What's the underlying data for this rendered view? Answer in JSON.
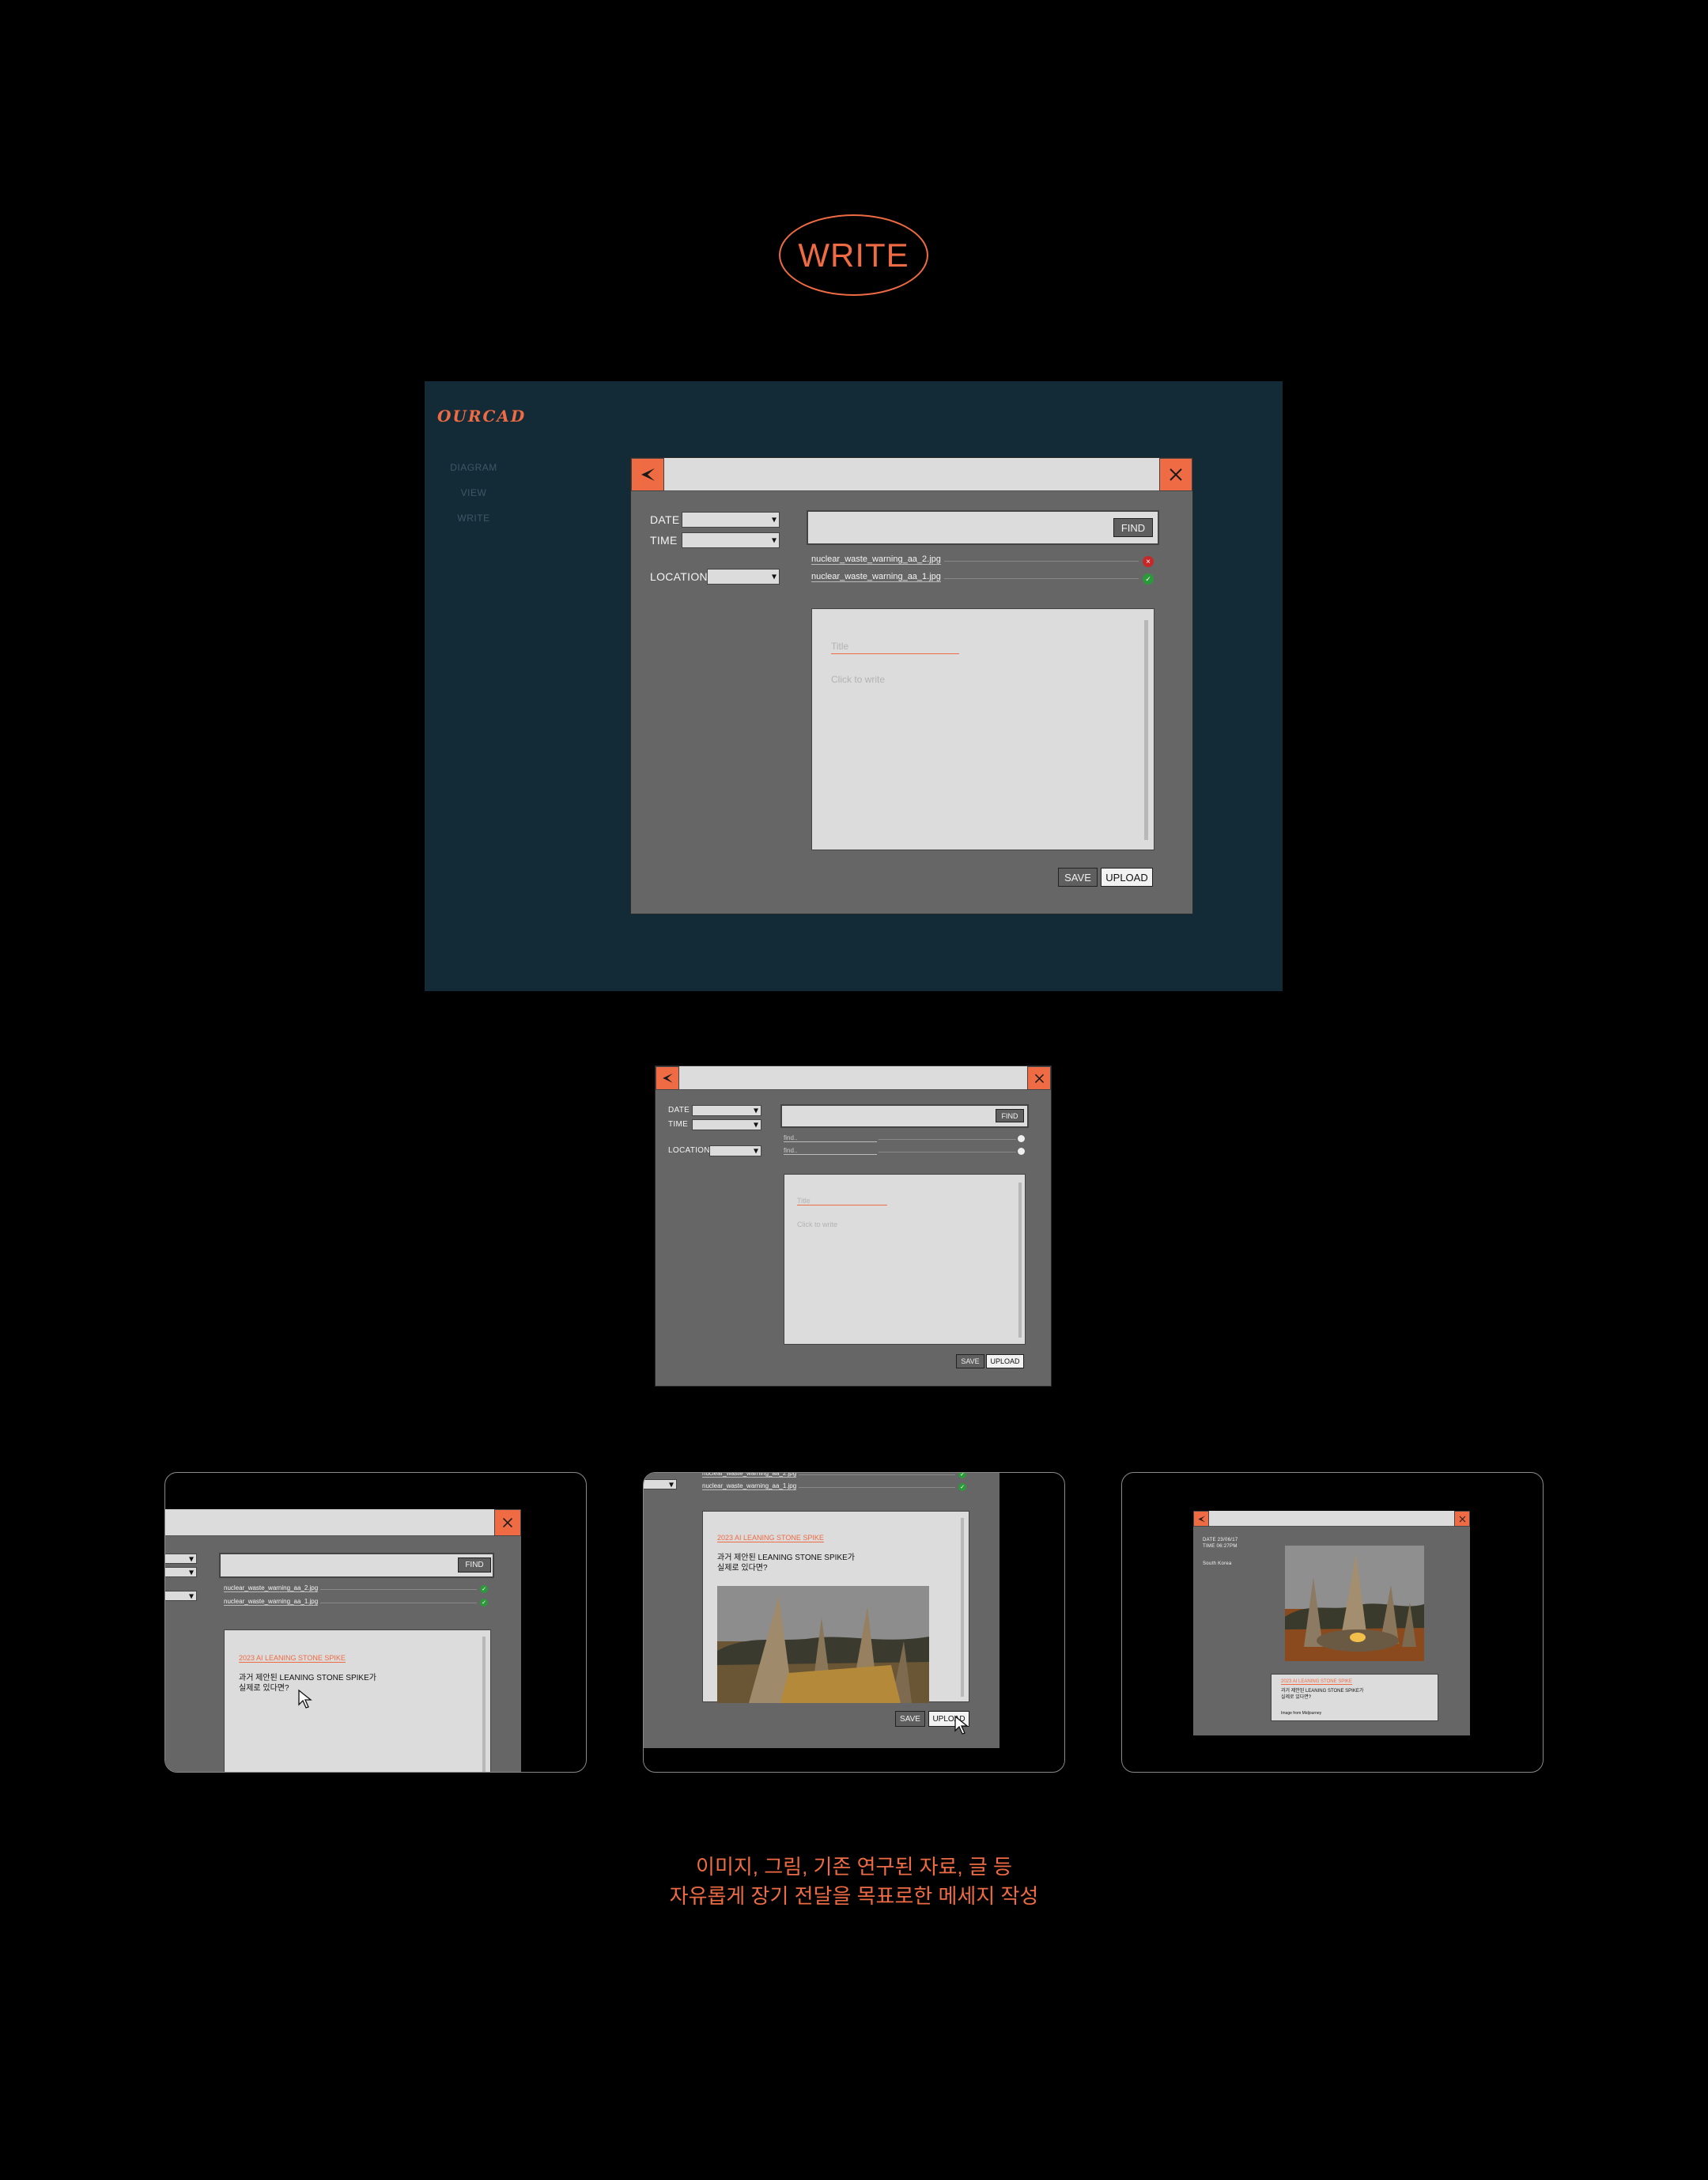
{
  "heading": {
    "label": "WRITE"
  },
  "app": {
    "logo": "OURCAD",
    "nav": [
      "DIAGRAM",
      "VIEW",
      "WRITE"
    ]
  },
  "writer": {
    "date_label": "DATE",
    "time_label": "TIME",
    "location_label": "LOCATION",
    "find_label": "FIND",
    "files": [
      "nuclear_waste_warning_aa_2.jpg",
      "nuclear_waste_warning_aa_1.jpg"
    ],
    "file_status": [
      "error",
      "ok"
    ],
    "title_placeholder": "Title",
    "body_placeholder": "Click to write",
    "save_label": "SAVE",
    "upload_label": "UPLOAD"
  },
  "writer_small": {
    "files": [
      "find..",
      "find.."
    ]
  },
  "post": {
    "tag": "2023 AI LEANING STONE SPIKE",
    "question_line1": "과거 제안된 LEANING STONE SPIKE가",
    "question_line2": "실제로 있다면?"
  },
  "preview": {
    "date": "DATE 23/06/17",
    "time": "TIME 06:27PM",
    "location": "South Korea",
    "credit": "Image from Midjourney"
  },
  "caption": {
    "line1": "이미지, 그림, 기존 연구된 자료, 글 등",
    "line2": "자유롭게 장기 전달을 목표로한 메세지 작성"
  },
  "colors": {
    "accent": "#ef6b44",
    "app_bg": "#132a37",
    "window_bg": "#666666",
    "panel": "#dcdcdc",
    "ok": "#2c9a3a",
    "error": "#c62828"
  },
  "icons": {
    "back": "back-arrow-icon",
    "close": "close-icon",
    "dropdown": "chevron-down-icon",
    "cursor": "cursor-icon"
  }
}
